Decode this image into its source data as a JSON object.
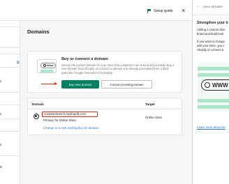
{
  "topbar": {
    "setup_guide_label": "Setup guide",
    "close_symbol": "×"
  },
  "sidebar": {
    "fragments": [
      "s",
      "s",
      "s",
      "ls"
    ],
    "external_icon": "⧉"
  },
  "page": {
    "title": "Domains"
  },
  "buy_card": {
    "illustration_text": "www",
    "title": "Buy or connect a domain",
    "description": "Secure the perfect domain for your store that customers can trust and find easily. Buy a new domain from Shopify, or connect a domain you already purchased from a third-party like Google Domains or GoDaddy.",
    "buy_button": "Buy new domain",
    "connect_button": "Connect existing domain"
  },
  "domains_table": {
    "headers": {
      "domain": "Domain",
      "target": "Target"
    },
    "rows": [
      {
        "domain": "creative3merch.myshopify.com",
        "primary_note": "Primary for Online Store",
        "target": "Online Store"
      }
    ],
    "change_link": "Change to a new myshopify.com domain"
  },
  "side_panel": {
    "back_symbol": "←",
    "header_label": "View all tasks",
    "title": "Strengthen your b",
    "para1_line1": "Adding a custom dom",
    "para1_line2": "brand and build trust",
    "para2_line1": "If you want to change",
    "para2_line2": "visit your store, you c",
    "para2_line3": "Shopify or connect a",
    "illustration_text": "WWW",
    "learn_more": "Learn more about do"
  },
  "colors": {
    "primary_green": "#008060",
    "link_blue": "#2c6ecb",
    "highlight_red": "#d72c0d"
  }
}
